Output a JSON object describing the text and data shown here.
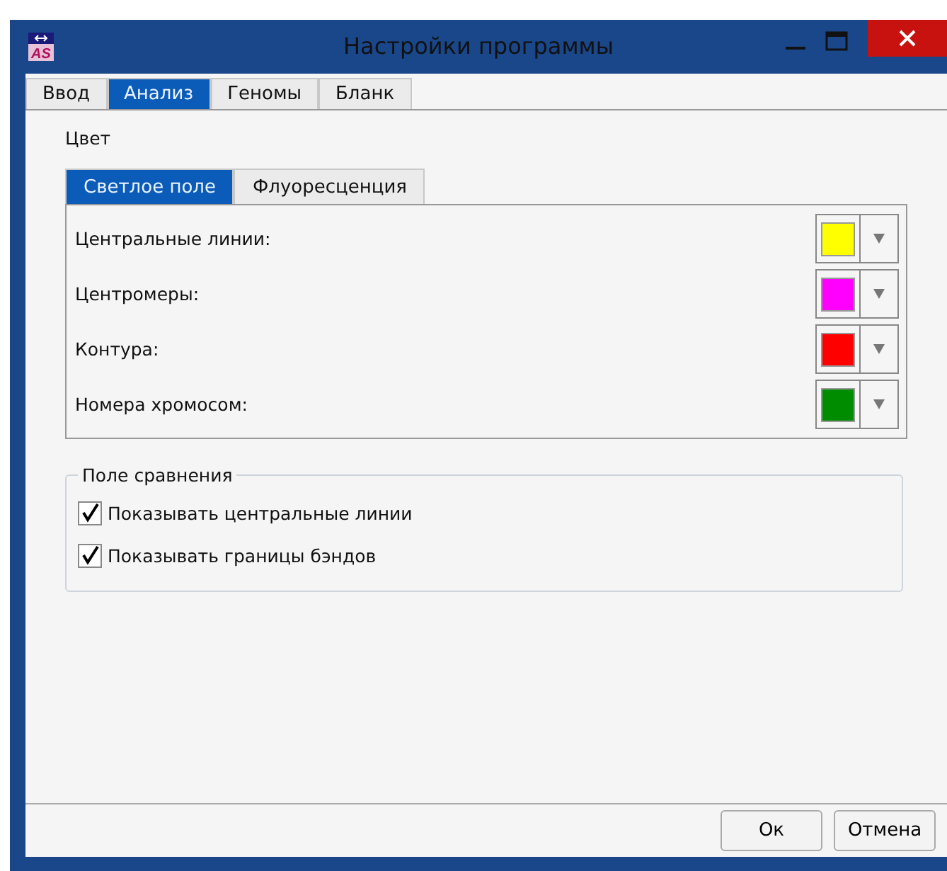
{
  "window": {
    "title": "Настройки программы",
    "logo_text": "AS"
  },
  "tabs": [
    {
      "label": "Ввод",
      "selected": false
    },
    {
      "label": "Анализ",
      "selected": true
    },
    {
      "label": "Геномы",
      "selected": false
    },
    {
      "label": "Бланк",
      "selected": false
    }
  ],
  "color_section": {
    "title": "Цвет",
    "tabs": [
      {
        "label": "Светлое поле",
        "selected": true
      },
      {
        "label": "Флуоресценция",
        "selected": false
      }
    ],
    "rows": [
      {
        "label": "Центральные линии:",
        "color": "#ffff00"
      },
      {
        "label": "Центромеры:",
        "color": "#ff00ff"
      },
      {
        "label": "Контура:",
        "color": "#ff0000"
      },
      {
        "label": "Номера хромосом:",
        "color": "#008c00"
      }
    ]
  },
  "comparison": {
    "title": "Поле сравнения",
    "options": [
      {
        "label": "Показывать центральные линии",
        "checked": true
      },
      {
        "label": "Показывать границы бэндов",
        "checked": true
      }
    ]
  },
  "buttons": [
    "Ок",
    "Отмена"
  ]
}
